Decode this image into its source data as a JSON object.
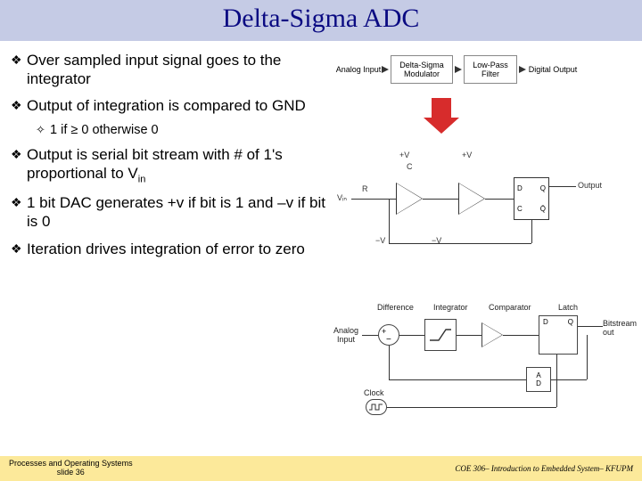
{
  "title": "Delta-Sigma ADC",
  "bullets": [
    {
      "text": "Over sampled input signal goes to the integrator"
    },
    {
      "text": "Output of integration is compared to GND",
      "sub": "1 if ≥ 0 otherwise 0"
    },
    {
      "text_html": "Output is serial bit stream with # of 1's proportional to V",
      "subscript": "in"
    },
    {
      "text": "1 bit DAC generates +v if bit is 1 and –v if bit is 0"
    },
    {
      "text": "Iteration drives integration of error to zero"
    }
  ],
  "top_diagram": {
    "blocks": [
      "Analog Input",
      "Delta-Sigma Modulator",
      "Low-Pass Filter",
      "Digital Output"
    ]
  },
  "circuit_labels": {
    "vin": "Vᵢₙ",
    "plusV": "+V",
    "minusV": "−V",
    "R": "R",
    "C": "C",
    "D": "D",
    "Q": "Q",
    "Qbar": "Q̄",
    "Cclk": "C",
    "Output": "Output"
  },
  "bottom_diagram": {
    "labels": [
      "Difference",
      "Integrator",
      "Comparator",
      "Latch"
    ],
    "analog_in": "Analog Input",
    "clock": "Clock",
    "bitstream": "Bitstream out",
    "plus": "+",
    "minus": "−",
    "D": "D",
    "Q": "Q",
    "A": "A"
  },
  "footer": {
    "left_line1": "Processes and Operating Systems",
    "left_line2": "slide 36",
    "right": "COE 306– Introduction to Embedded System– KFUPM"
  }
}
